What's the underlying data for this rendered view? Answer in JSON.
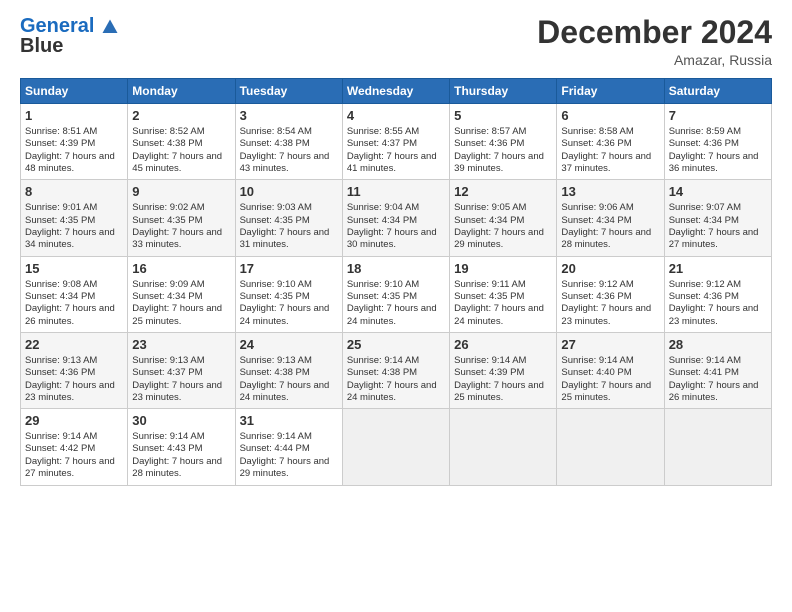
{
  "header": {
    "logo_line1": "General",
    "logo_line2": "Blue",
    "main_title": "December 2024",
    "subtitle": "Amazar, Russia"
  },
  "calendar": {
    "days_of_week": [
      "Sunday",
      "Monday",
      "Tuesday",
      "Wednesday",
      "Thursday",
      "Friday",
      "Saturday"
    ],
    "weeks": [
      [
        {
          "day": "1",
          "sunrise": "Sunrise: 8:51 AM",
          "sunset": "Sunset: 4:39 PM",
          "daylight": "Daylight: 7 hours and 48 minutes."
        },
        {
          "day": "2",
          "sunrise": "Sunrise: 8:52 AM",
          "sunset": "Sunset: 4:38 PM",
          "daylight": "Daylight: 7 hours and 45 minutes."
        },
        {
          "day": "3",
          "sunrise": "Sunrise: 8:54 AM",
          "sunset": "Sunset: 4:38 PM",
          "daylight": "Daylight: 7 hours and 43 minutes."
        },
        {
          "day": "4",
          "sunrise": "Sunrise: 8:55 AM",
          "sunset": "Sunset: 4:37 PM",
          "daylight": "Daylight: 7 hours and 41 minutes."
        },
        {
          "day": "5",
          "sunrise": "Sunrise: 8:57 AM",
          "sunset": "Sunset: 4:36 PM",
          "daylight": "Daylight: 7 hours and 39 minutes."
        },
        {
          "day": "6",
          "sunrise": "Sunrise: 8:58 AM",
          "sunset": "Sunset: 4:36 PM",
          "daylight": "Daylight: 7 hours and 37 minutes."
        },
        {
          "day": "7",
          "sunrise": "Sunrise: 8:59 AM",
          "sunset": "Sunset: 4:36 PM",
          "daylight": "Daylight: 7 hours and 36 minutes."
        }
      ],
      [
        {
          "day": "8",
          "sunrise": "Sunrise: 9:01 AM",
          "sunset": "Sunset: 4:35 PM",
          "daylight": "Daylight: 7 hours and 34 minutes."
        },
        {
          "day": "9",
          "sunrise": "Sunrise: 9:02 AM",
          "sunset": "Sunset: 4:35 PM",
          "daylight": "Daylight: 7 hours and 33 minutes."
        },
        {
          "day": "10",
          "sunrise": "Sunrise: 9:03 AM",
          "sunset": "Sunset: 4:35 PM",
          "daylight": "Daylight: 7 hours and 31 minutes."
        },
        {
          "day": "11",
          "sunrise": "Sunrise: 9:04 AM",
          "sunset": "Sunset: 4:34 PM",
          "daylight": "Daylight: 7 hours and 30 minutes."
        },
        {
          "day": "12",
          "sunrise": "Sunrise: 9:05 AM",
          "sunset": "Sunset: 4:34 PM",
          "daylight": "Daylight: 7 hours and 29 minutes."
        },
        {
          "day": "13",
          "sunrise": "Sunrise: 9:06 AM",
          "sunset": "Sunset: 4:34 PM",
          "daylight": "Daylight: 7 hours and 28 minutes."
        },
        {
          "day": "14",
          "sunrise": "Sunrise: 9:07 AM",
          "sunset": "Sunset: 4:34 PM",
          "daylight": "Daylight: 7 hours and 27 minutes."
        }
      ],
      [
        {
          "day": "15",
          "sunrise": "Sunrise: 9:08 AM",
          "sunset": "Sunset: 4:34 PM",
          "daylight": "Daylight: 7 hours and 26 minutes."
        },
        {
          "day": "16",
          "sunrise": "Sunrise: 9:09 AM",
          "sunset": "Sunset: 4:34 PM",
          "daylight": "Daylight: 7 hours and 25 minutes."
        },
        {
          "day": "17",
          "sunrise": "Sunrise: 9:10 AM",
          "sunset": "Sunset: 4:35 PM",
          "daylight": "Daylight: 7 hours and 24 minutes."
        },
        {
          "day": "18",
          "sunrise": "Sunrise: 9:10 AM",
          "sunset": "Sunset: 4:35 PM",
          "daylight": "Daylight: 7 hours and 24 minutes."
        },
        {
          "day": "19",
          "sunrise": "Sunrise: 9:11 AM",
          "sunset": "Sunset: 4:35 PM",
          "daylight": "Daylight: 7 hours and 24 minutes."
        },
        {
          "day": "20",
          "sunrise": "Sunrise: 9:12 AM",
          "sunset": "Sunset: 4:36 PM",
          "daylight": "Daylight: 7 hours and 23 minutes."
        },
        {
          "day": "21",
          "sunrise": "Sunrise: 9:12 AM",
          "sunset": "Sunset: 4:36 PM",
          "daylight": "Daylight: 7 hours and 23 minutes."
        }
      ],
      [
        {
          "day": "22",
          "sunrise": "Sunrise: 9:13 AM",
          "sunset": "Sunset: 4:36 PM",
          "daylight": "Daylight: 7 hours and 23 minutes."
        },
        {
          "day": "23",
          "sunrise": "Sunrise: 9:13 AM",
          "sunset": "Sunset: 4:37 PM",
          "daylight": "Daylight: 7 hours and 23 minutes."
        },
        {
          "day": "24",
          "sunrise": "Sunrise: 9:13 AM",
          "sunset": "Sunset: 4:38 PM",
          "daylight": "Daylight: 7 hours and 24 minutes."
        },
        {
          "day": "25",
          "sunrise": "Sunrise: 9:14 AM",
          "sunset": "Sunset: 4:38 PM",
          "daylight": "Daylight: 7 hours and 24 minutes."
        },
        {
          "day": "26",
          "sunrise": "Sunrise: 9:14 AM",
          "sunset": "Sunset: 4:39 PM",
          "daylight": "Daylight: 7 hours and 25 minutes."
        },
        {
          "day": "27",
          "sunrise": "Sunrise: 9:14 AM",
          "sunset": "Sunset: 4:40 PM",
          "daylight": "Daylight: 7 hours and 25 minutes."
        },
        {
          "day": "28",
          "sunrise": "Sunrise: 9:14 AM",
          "sunset": "Sunset: 4:41 PM",
          "daylight": "Daylight: 7 hours and 26 minutes."
        }
      ],
      [
        {
          "day": "29",
          "sunrise": "Sunrise: 9:14 AM",
          "sunset": "Sunset: 4:42 PM",
          "daylight": "Daylight: 7 hours and 27 minutes."
        },
        {
          "day": "30",
          "sunrise": "Sunrise: 9:14 AM",
          "sunset": "Sunset: 4:43 PM",
          "daylight": "Daylight: 7 hours and 28 minutes."
        },
        {
          "day": "31",
          "sunrise": "Sunrise: 9:14 AM",
          "sunset": "Sunset: 4:44 PM",
          "daylight": "Daylight: 7 hours and 29 minutes."
        },
        null,
        null,
        null,
        null
      ]
    ]
  }
}
